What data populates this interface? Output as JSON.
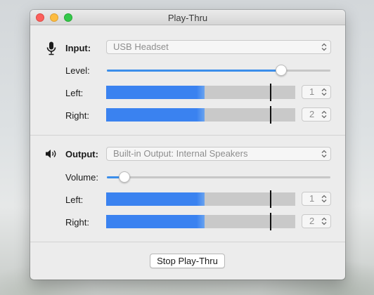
{
  "window": {
    "title": "Play-Thru"
  },
  "input": {
    "label": "Input:",
    "device": "USB Headset",
    "level_label": "Level:",
    "level_value": 0.78,
    "left_label": "Left:",
    "right_label": "Right:",
    "left_meter": {
      "level": 0.52,
      "peak": 0.87,
      "channel": "1"
    },
    "right_meter": {
      "level": 0.52,
      "peak": 0.87,
      "channel": "2"
    }
  },
  "output": {
    "label": "Output:",
    "device": "Built-in Output: Internal Speakers",
    "volume_label": "Volume:",
    "volume_value": 0.08,
    "left_label": "Left:",
    "right_label": "Right:",
    "left_meter": {
      "level": 0.52,
      "peak": 0.87,
      "channel": "1"
    },
    "right_meter": {
      "level": 0.52,
      "peak": 0.87,
      "channel": "2"
    }
  },
  "action": {
    "stop_label": "Stop Play-Thru"
  },
  "colors": {
    "accent": "#3b8eea",
    "meter_fill": "#3a82f0",
    "meter_bg": "#c9c9c9",
    "peak": "#111111"
  },
  "icons": {
    "input": "microphone-icon",
    "output": "speaker-icon",
    "popup_arrows": "up-down-chevron-icon"
  }
}
